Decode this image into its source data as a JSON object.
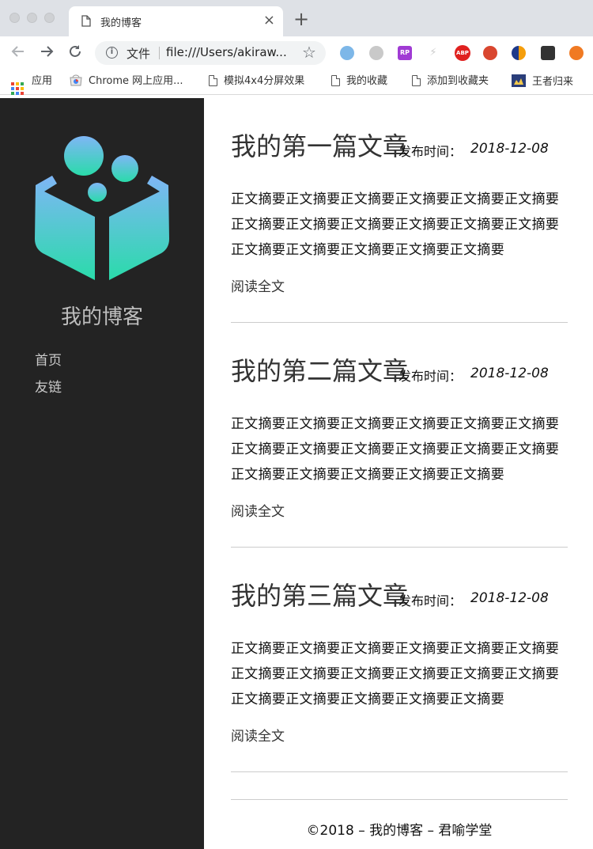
{
  "browser": {
    "tab_title": "我的博客",
    "new_tab": "+",
    "close": "×",
    "url_scheme": "文件",
    "url": "file:///Users/akiraw...",
    "extensions": [
      {
        "name": "circle-ext-icon",
        "color": "#7db7e8",
        "label": ""
      },
      {
        "name": "moon-ext-icon",
        "color": "#c9c9c9",
        "label": ""
      },
      {
        "name": "rp-ext-icon",
        "color": "#a03bd4",
        "label": "RP"
      },
      {
        "name": "bolt-ext-icon",
        "color": "#e5e5e5",
        "label": "⚡"
      },
      {
        "name": "abp-ext-icon",
        "color": "#e0211f",
        "label": "ABP"
      },
      {
        "name": "santa-ext-icon",
        "color": "#d9462f",
        "label": ""
      },
      {
        "name": "half-circle-ext-icon",
        "color": "#1e3a8a",
        "label": ""
      },
      {
        "name": "shield-ext-icon",
        "color": "#333333",
        "label": ""
      },
      {
        "name": "lifebuoy-ext-icon",
        "color": "#f07a23",
        "label": ""
      }
    ],
    "bookmarks": [
      {
        "label": "应用",
        "icon": "apps-grid-icon"
      },
      {
        "label": "Chrome 网上应用...",
        "icon": "chrome-store-icon"
      },
      {
        "label": "模拟4x4分屏效果",
        "icon": "document-icon"
      },
      {
        "label": "我的收藏",
        "icon": "document-icon"
      },
      {
        "label": "添加到收藏夹",
        "icon": "document-icon"
      },
      {
        "label": "王者归来",
        "icon": "game-icon"
      }
    ]
  },
  "sidebar": {
    "site_title": "我的博客",
    "nav": [
      {
        "label": "首页"
      },
      {
        "label": "友链"
      }
    ],
    "logo_colors": {
      "top": "#7fb6f6",
      "bottom": "#2adbaa"
    }
  },
  "posts": [
    {
      "title": "我的第一篇文章",
      "date_label": "发布时间：",
      "date": "2018-12-08",
      "summary": "正文摘要正文摘要正文摘要正文摘要正文摘要正文摘要正文摘要正文摘要正文摘要正文摘要正文摘要正文摘要正文摘要正文摘要正文摘要正文摘要正文摘要",
      "read_more": "阅读全文"
    },
    {
      "title": "我的第二篇文章",
      "date_label": "发布时间：",
      "date": "2018-12-08",
      "summary": "正文摘要正文摘要正文摘要正文摘要正文摘要正文摘要正文摘要正文摘要正文摘要正文摘要正文摘要正文摘要正文摘要正文摘要正文摘要正文摘要正文摘要",
      "read_more": "阅读全文"
    },
    {
      "title": "我的第三篇文章",
      "date_label": "发布时间：",
      "date": "2018-12-08",
      "summary": "正文摘要正文摘要正文摘要正文摘要正文摘要正文摘要正文摘要正文摘要正文摘要正文摘要正文摘要正文摘要正文摘要正文摘要正文摘要正文摘要正文摘要",
      "read_more": "阅读全文"
    }
  ],
  "footer": "©2018 – 我的博客 – 君喻学堂"
}
